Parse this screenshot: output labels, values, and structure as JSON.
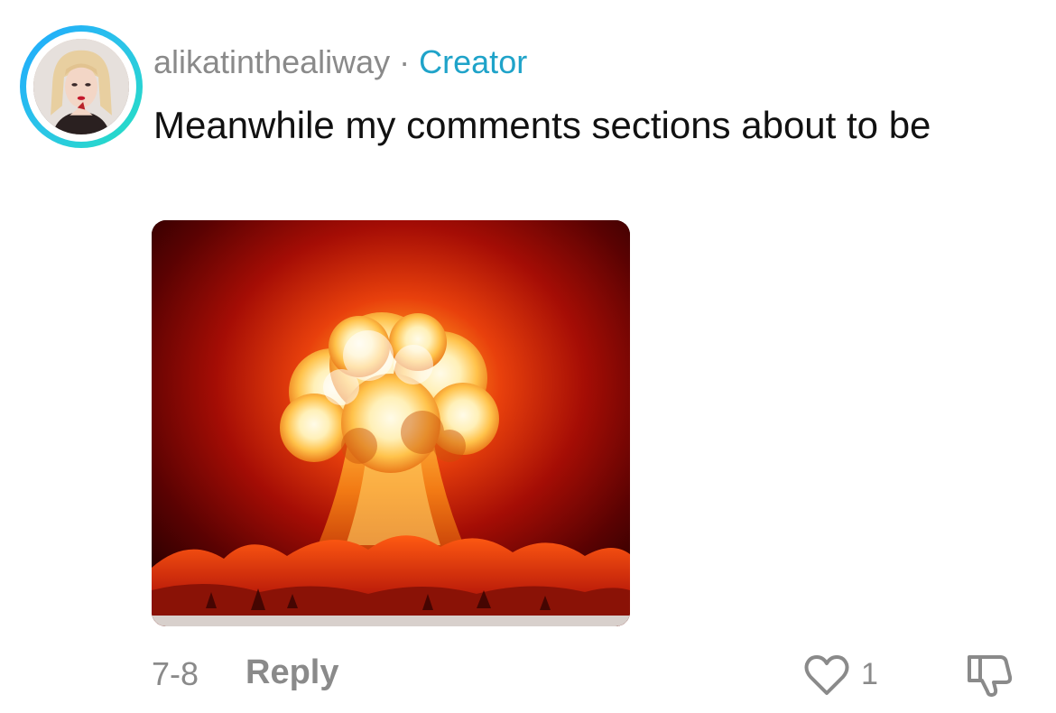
{
  "comment": {
    "username": "alikatinthealiway",
    "separator": "·",
    "badge": "Creator",
    "text": "Meanwhile my comments sections about to be",
    "media": {
      "description_icon": "explosion-image"
    },
    "date": "7-8",
    "reply_label": "Reply",
    "like_count": "1",
    "icons": {
      "like": "heart-outline-icon",
      "dislike": "thumbs-down-icon"
    }
  },
  "colors": {
    "username": "#8a8a8a",
    "badge": "#1fa3c9",
    "ring_start": "#1fa8ff",
    "ring_end": "#25e0c0",
    "text": "#111111",
    "meta": "#8a8a8a"
  }
}
